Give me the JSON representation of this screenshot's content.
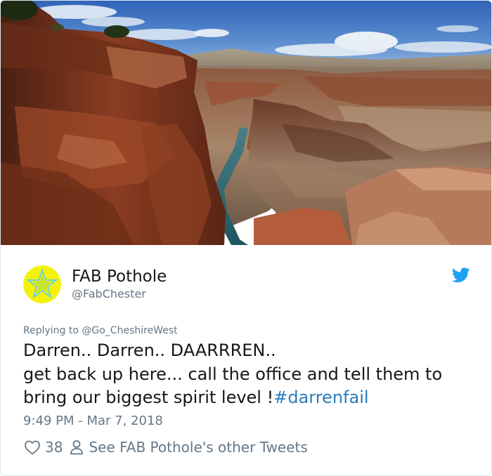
{
  "tweet": {
    "author": {
      "display_name": "FAB Pothole",
      "handle": "@FabChester",
      "avatar_icon": "yellow-star-avatar"
    },
    "brand_icon": "twitter-bird-icon",
    "reply_prefix": "Replying to ",
    "reply_to": "@Go_CheshireWest",
    "text_lines": [
      "Darren.. Darren.. DAARRREN..",
      "get back up here... call the office and tell them to",
      "bring our biggest spirit level !"
    ],
    "hashtag": "#darrenfail",
    "timestamp": "9:49 PM - Mar 7, 2018",
    "like_count": "38",
    "profile_link_text": "See FAB Pothole's other Tweets"
  },
  "colors": {
    "text": "#14171a",
    "muted": "#657786",
    "link": "#2b7bb9",
    "twitter_blue": "#1da1f2",
    "avatar_bg": "#f5f20a"
  }
}
